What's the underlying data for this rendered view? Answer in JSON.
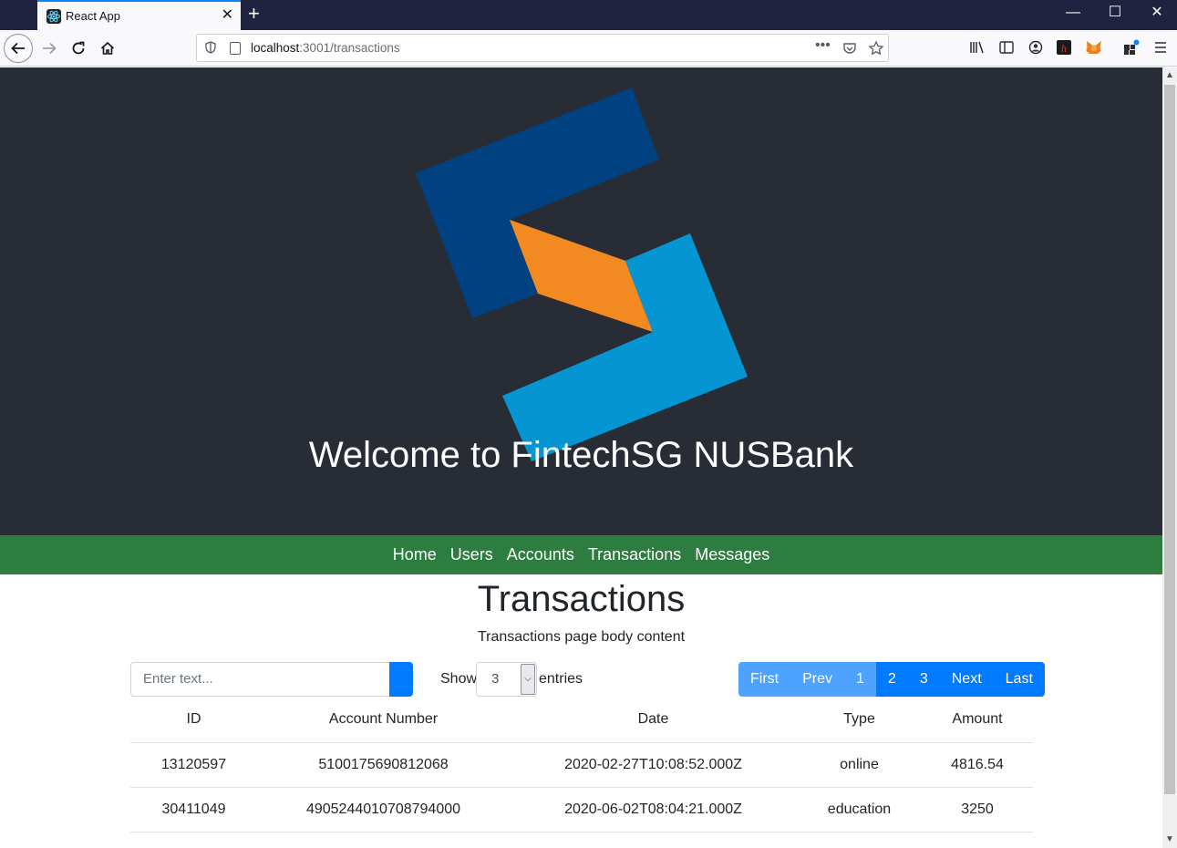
{
  "browser": {
    "tab_title": "React App",
    "url_host": "localhost",
    "url_rest": ":3001/transactions"
  },
  "hero": {
    "title": "Welcome to FintechSG NUSBank",
    "logo_colors": {
      "dark_blue": "#004182",
      "light_blue": "#0595d2",
      "orange": "#f28a21",
      "background": "#282c34"
    }
  },
  "menu": {
    "items": [
      "Home",
      "Users",
      "Accounts",
      "Transactions",
      "Messages"
    ],
    "bar_color": "#2e7d40"
  },
  "page": {
    "title": "Transactions",
    "subtitle": "Transactions page body content"
  },
  "controls": {
    "search_placeholder": "Enter text...",
    "show_label": "Show",
    "entries_value": "3",
    "entries_label": "entries"
  },
  "pagination": {
    "first": "First",
    "prev": "Prev",
    "pages": [
      "1",
      "2",
      "3"
    ],
    "current": "1",
    "next": "Next",
    "last": "Last"
  },
  "table": {
    "columns": [
      "ID",
      "Account Number",
      "Date",
      "Type",
      "Amount"
    ],
    "rows": [
      [
        "13120597",
        "5100175690812068",
        "2020-02-27T10:08:52.000Z",
        "online",
        "4816.54"
      ],
      [
        "30411049",
        "4905244010708794000",
        "2020-06-02T08:04:21.000Z",
        "education",
        "3250"
      ]
    ]
  }
}
